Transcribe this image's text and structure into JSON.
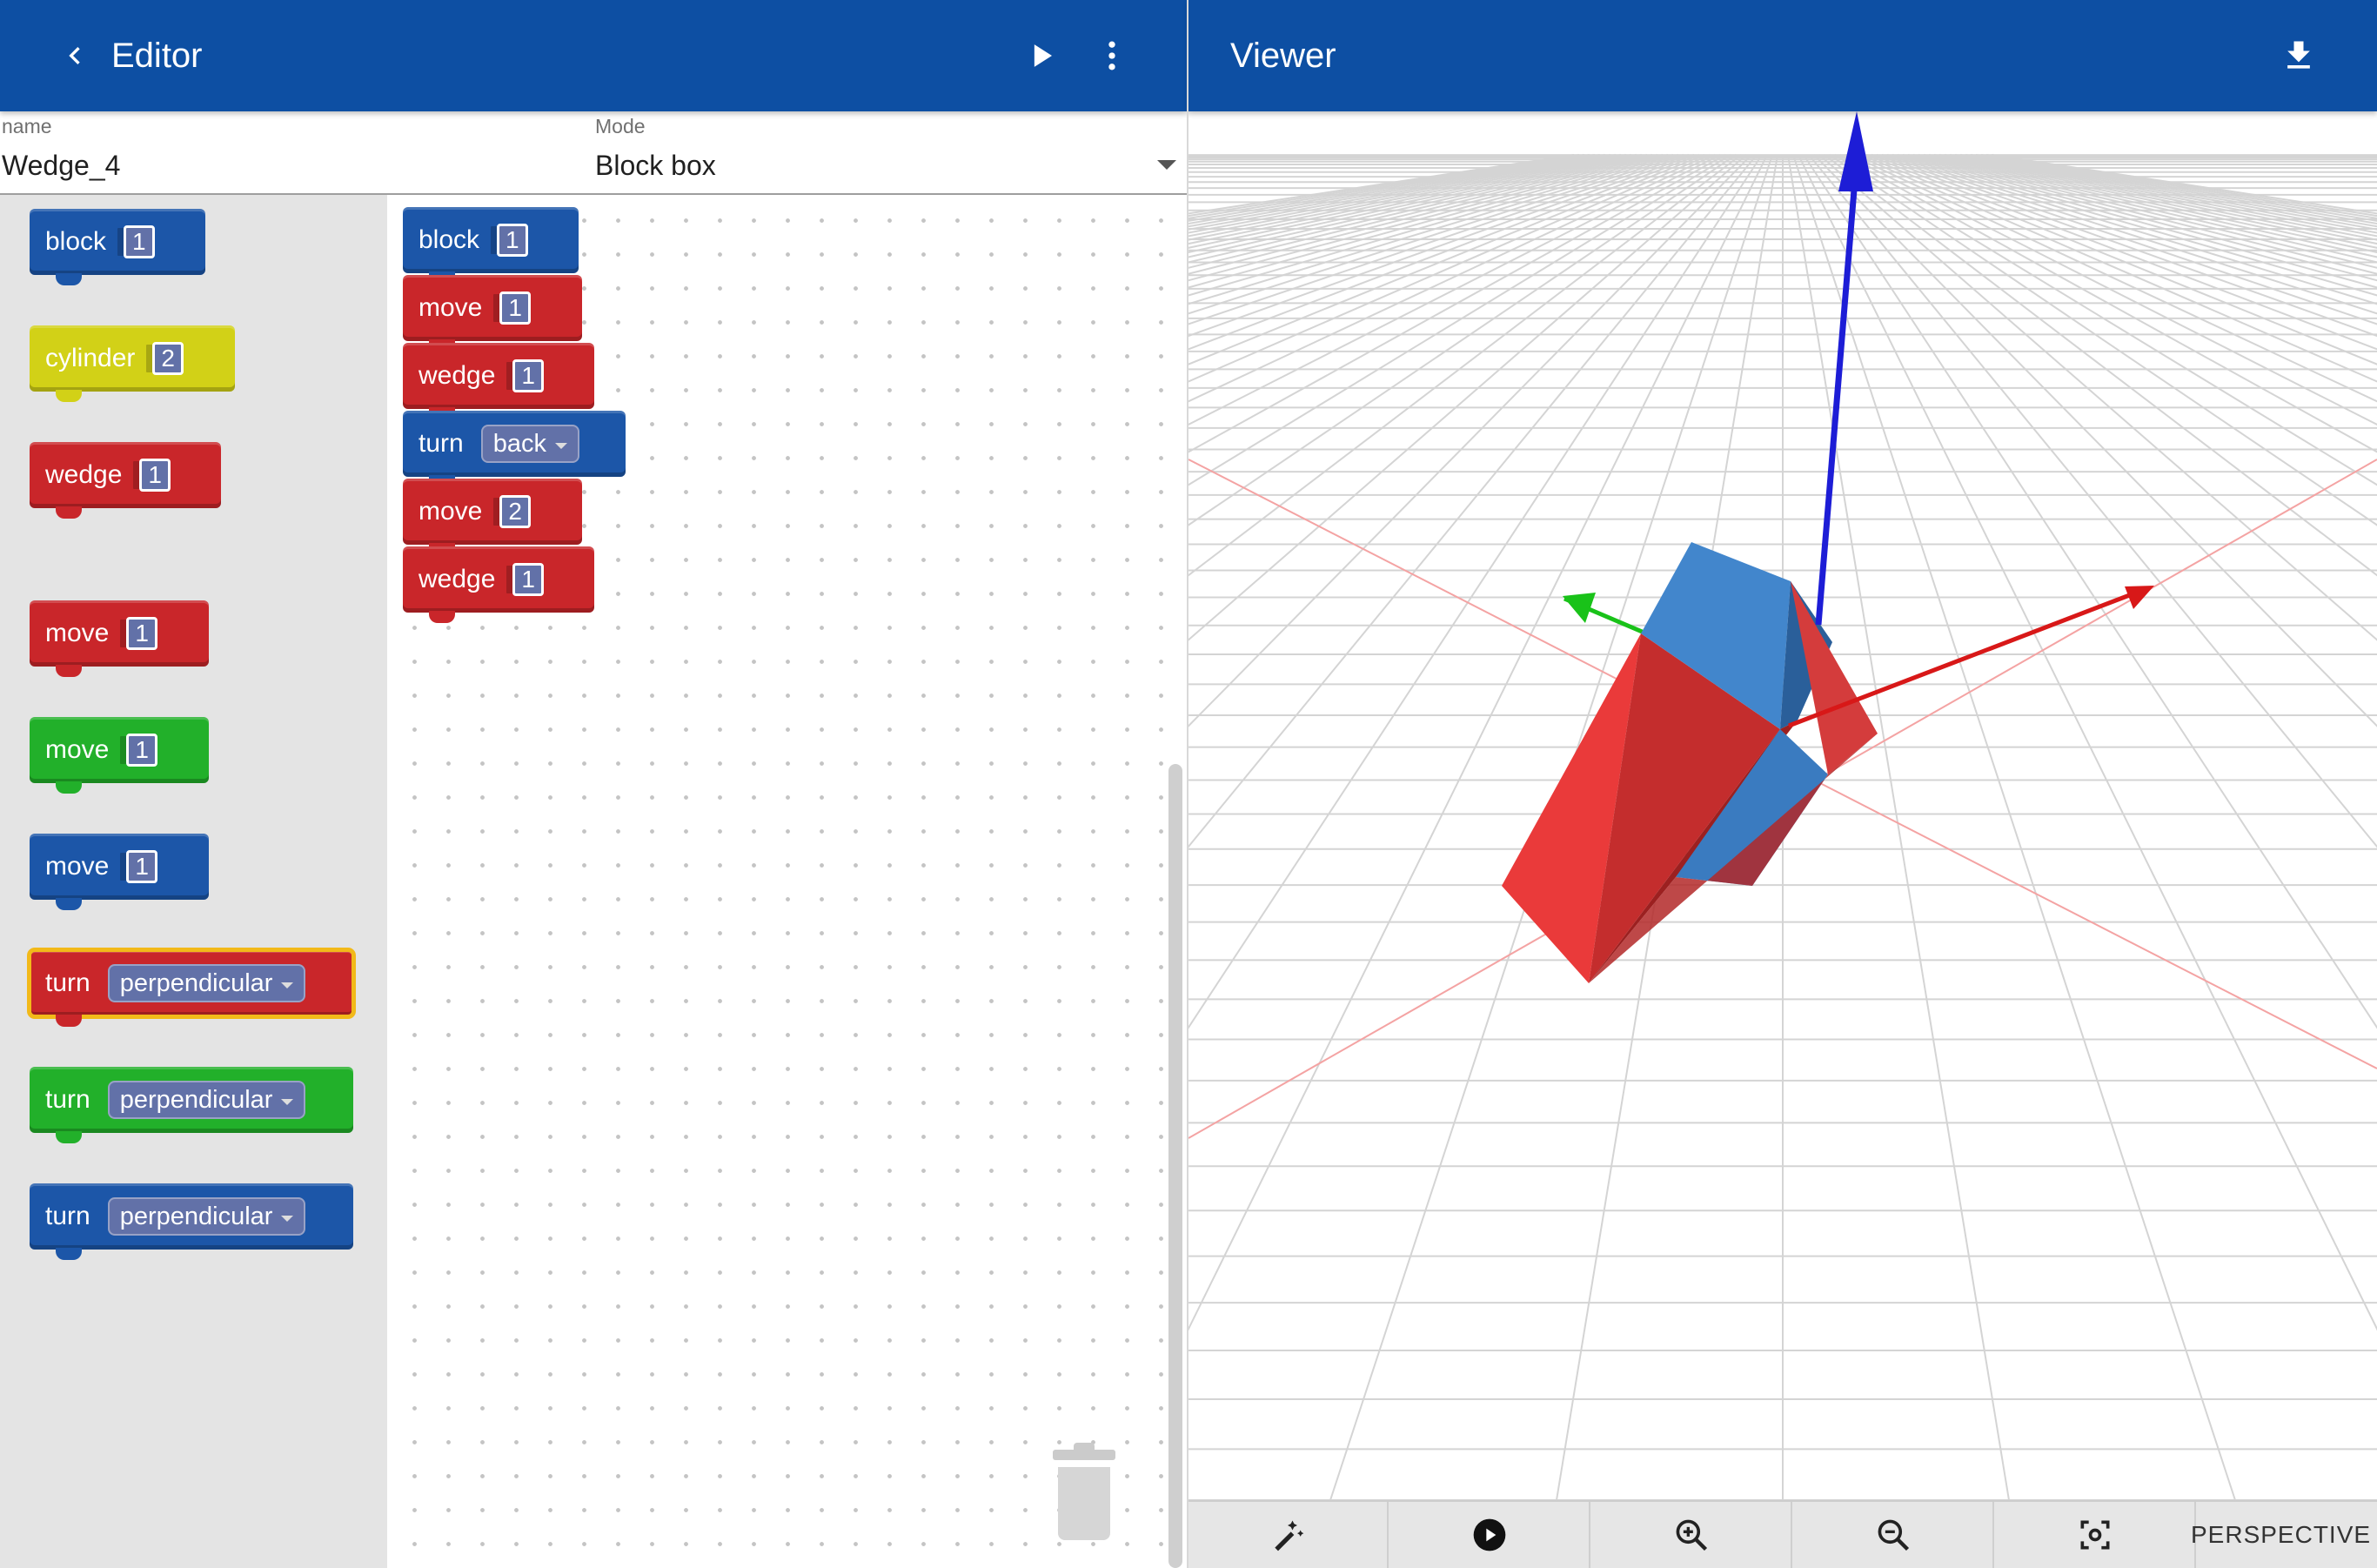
{
  "editor": {
    "title": "Editor",
    "name_label": "name",
    "name_value": "Wedge_4",
    "mode_label": "Mode",
    "mode_value": "Block box"
  },
  "viewer": {
    "title": "Viewer",
    "camera_mode": "PERSPECTIVE"
  },
  "toolbox": [
    {
      "label": "block",
      "value": "1",
      "color": "#1c56a8"
    },
    {
      "label": "cylinder",
      "value": "2",
      "color": "#d2d117"
    },
    {
      "label": "wedge",
      "value": "1",
      "color": "#c9262a"
    },
    {
      "label": "move",
      "value": "1",
      "color": "#c9262a"
    },
    {
      "label": "move",
      "value": "1",
      "color": "#22b02a"
    },
    {
      "label": "move",
      "value": "1",
      "color": "#1c56a8"
    },
    {
      "label": "turn",
      "value": "perpendicular",
      "color": "#c9262a"
    },
    {
      "label": "turn",
      "value": "perpendicular",
      "color": "#22b02a"
    },
    {
      "label": "turn",
      "value": "perpendicular",
      "color": "#1c56a8"
    }
  ],
  "program": [
    {
      "label": "block",
      "value": "1",
      "color": "#1c56a8"
    },
    {
      "label": "move",
      "value": "1",
      "color": "#c9262a"
    },
    {
      "label": "wedge",
      "value": "1",
      "color": "#c9262a"
    },
    {
      "label": "turn",
      "value": "back",
      "color": "#1c56a8"
    },
    {
      "label": "move",
      "value": "2",
      "color": "#c9262a"
    },
    {
      "label": "wedge",
      "value": "1",
      "color": "#c9262a"
    }
  ],
  "icons": {
    "back": "chevron-left-icon",
    "run": "play-icon",
    "menu": "more-vert-icon",
    "download": "download-icon",
    "magic": "magic-wand-icon",
    "play": "play-circle-icon",
    "zoom_in": "zoom-in-icon",
    "zoom_out": "zoom-out-icon",
    "fit": "center-focus-icon",
    "trash": "trash-icon"
  }
}
